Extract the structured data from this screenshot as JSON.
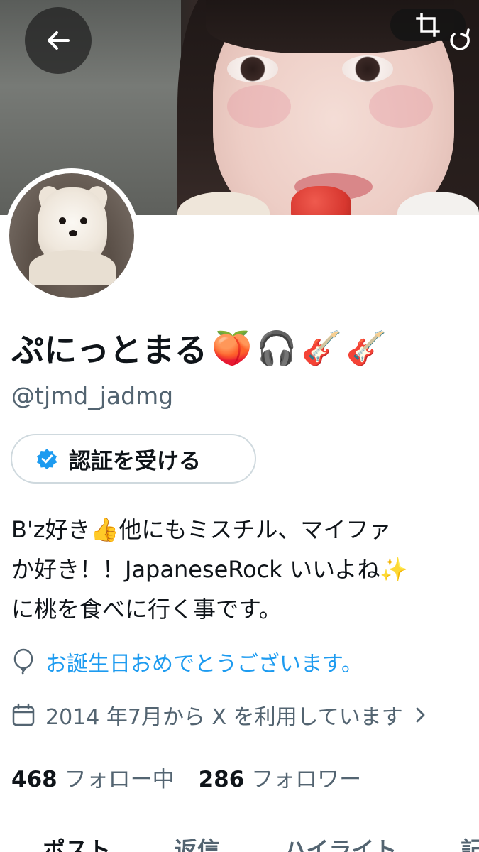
{
  "profile": {
    "display_name": "ぷにっとまる",
    "name_emojis": [
      "🍑",
      "🎧",
      "🎸",
      "🎸"
    ],
    "handle": "@tjmd_jadmg"
  },
  "verify": {
    "label": "認証を受ける"
  },
  "bio": {
    "lines": [
      "B'z好き👍他にもミスチル、マイファ",
      "か好き！！JapaneseRock いいよね✨",
      "に桃を食べに行く事です。"
    ]
  },
  "meta": {
    "birthday": "お誕生日おめでとうございます。",
    "joined": "2014 年7月から X を利用しています"
  },
  "stats": {
    "following_count": "468",
    "following_label": "フォロー中",
    "followers_count": "286",
    "followers_label": "フォロワー"
  },
  "tabs": [
    "ポスト",
    "返信",
    "ハイライト",
    "記"
  ],
  "colors": {
    "accent": "#1d9bf0",
    "muted": "#536471",
    "text": "#0f1419"
  }
}
